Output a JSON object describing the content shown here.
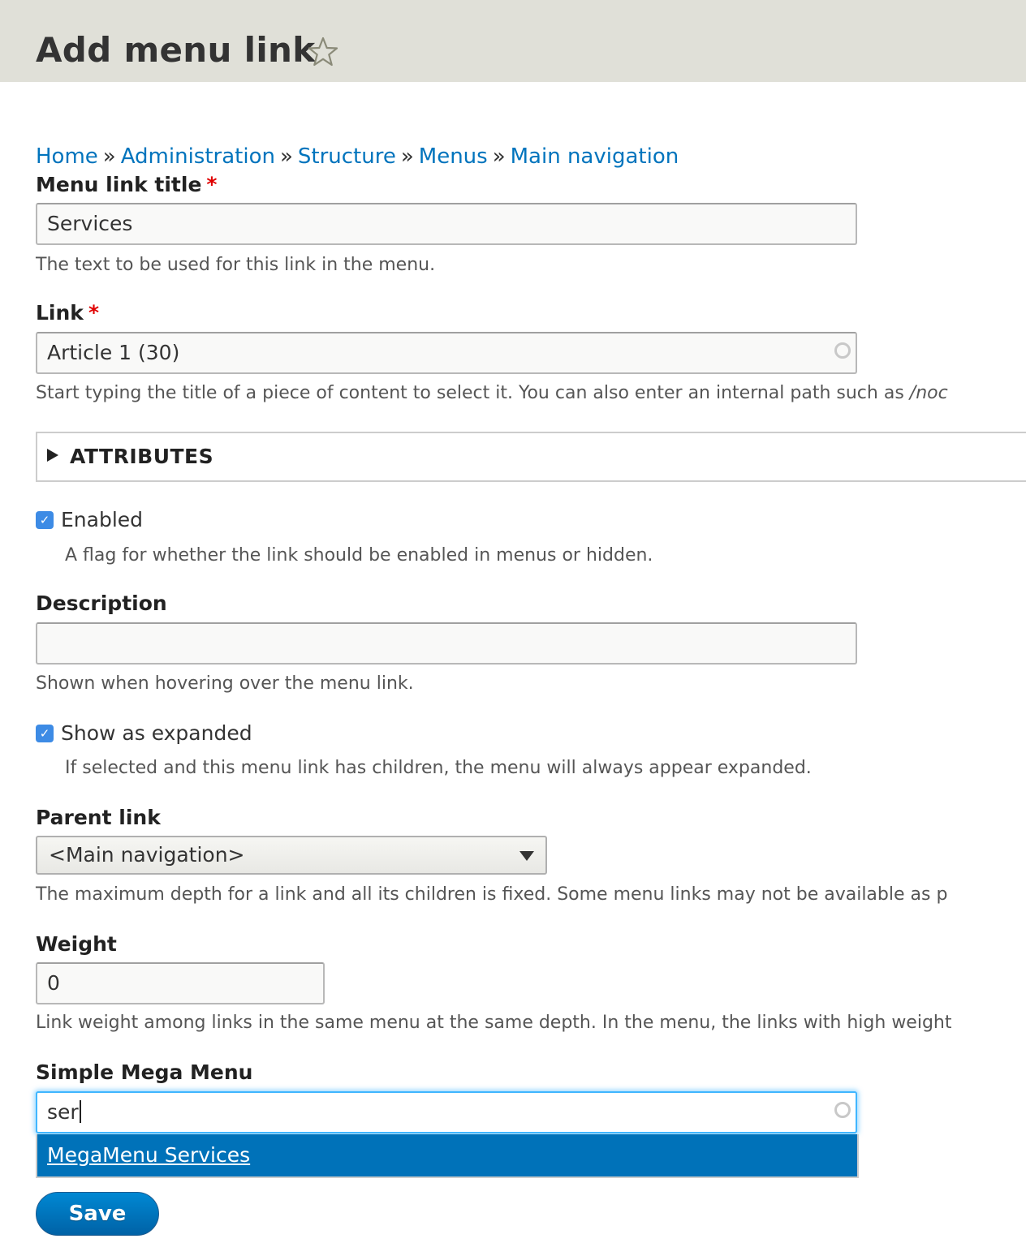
{
  "header": {
    "title": "Add menu link",
    "shortcut_icon": "star-outline-icon"
  },
  "breadcrumb": [
    {
      "label": "Home"
    },
    {
      "label": "Administration"
    },
    {
      "label": "Structure"
    },
    {
      "label": "Menus"
    },
    {
      "label": "Main navigation"
    }
  ],
  "breadcrumb_separator": "»",
  "form": {
    "title": {
      "label": "Menu link title",
      "required_marker": "*",
      "value": "Services",
      "description": "The text to be used for this link in the menu."
    },
    "link": {
      "label": "Link",
      "required_marker": "*",
      "value": "Article 1 (30)",
      "description_prefix": "Start typing the title of a piece of content to select it. You can also enter an internal path such as ",
      "description_em": "/noc"
    },
    "attributes": {
      "label": "ATTRIBUTES",
      "expanded": false
    },
    "enabled": {
      "label": "Enabled",
      "checked": true,
      "description": "A flag for whether the link should be enabled in menus or hidden."
    },
    "description": {
      "label": "Description",
      "value": "",
      "description": "Shown when hovering over the menu link."
    },
    "expanded": {
      "label": "Show as expanded",
      "checked": true,
      "description": "If selected and this menu link has children, the menu will always appear expanded."
    },
    "parent": {
      "label": "Parent link",
      "selected": "<Main navigation>",
      "description": "The maximum depth for a link and all its children is fixed. Some menu links may not be available as p"
    },
    "weight": {
      "label": "Weight",
      "value": "0",
      "description": "Link weight among links in the same menu at the same depth. In the menu, the links with high weight"
    },
    "mega_menu": {
      "label": "Simple Mega Menu",
      "value": "ser",
      "suggestions": [
        {
          "label": "MegaMenu Services"
        }
      ]
    },
    "save_label": "Save"
  },
  "colors": {
    "link": "#0074bd",
    "required": "#e00000",
    "header_bg": "#e0e0d8",
    "checkbox": "#3d8be5",
    "autocomplete_bg": "#0072b9",
    "focus_ring": "#40b6ff"
  }
}
